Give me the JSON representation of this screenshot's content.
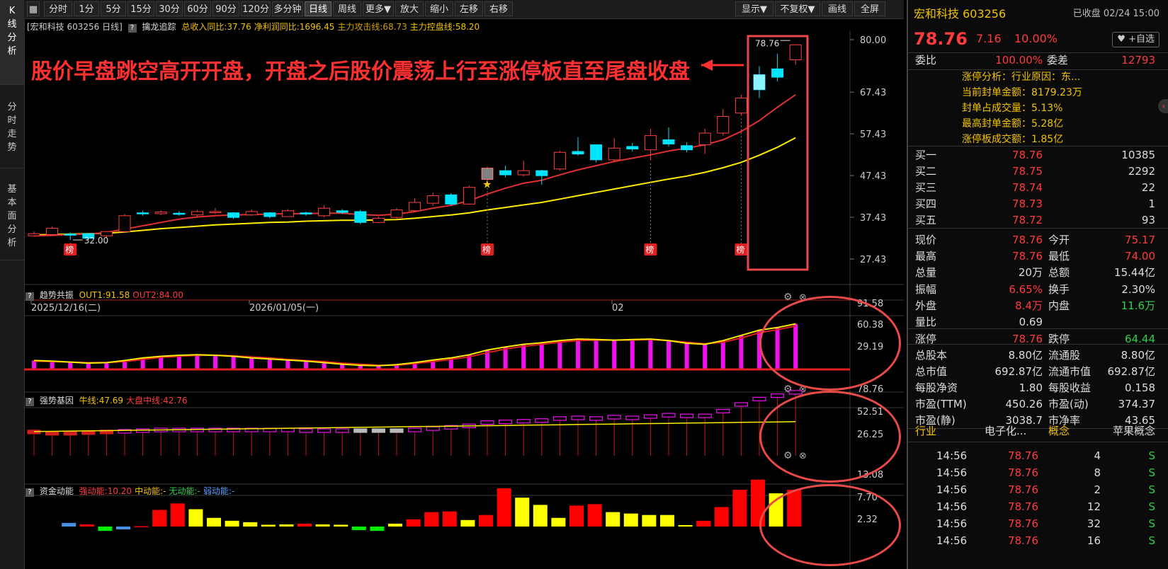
{
  "toolbar": {
    "buttons": [
      "分时",
      "1分",
      "5分",
      "15分",
      "30分",
      "60分",
      "90分",
      "120分",
      "多分钟",
      "日线",
      "周线",
      "更多▼",
      "放大",
      "缩小",
      "左移",
      "右移"
    ],
    "right_buttons": [
      "显示▼",
      "不复权▼",
      "画线",
      "全屏"
    ]
  },
  "left_tabs": [
    "K线分析",
    "分时走势",
    "基本面分析"
  ],
  "main_chart": {
    "title": "[宏和科技 603256 日线]",
    "indicator": "擒龙追踪",
    "items": [
      {
        "label": "总收入同比:37.76",
        "color": "#f3c300"
      },
      {
        "label": "净利润同比:1696.45",
        "color": "#f3c300"
      },
      {
        "label": "主力攻击线:68.73",
        "color": "#d0a000"
      },
      {
        "label": "主力控盘线:58.20",
        "color": "#f3c300"
      }
    ],
    "y_ticks": [
      "80.00",
      "67.43",
      "57.43",
      "47.43",
      "37.43",
      "27.43"
    ],
    "x_dates": [
      "2025/12/16(二)",
      "2026/01/05(一)",
      "02"
    ],
    "annotation": "股价早盘跳空高开开盘，开盘之后股价震荡上行至涨停板直至尾盘收盘",
    "high_label": "78.76",
    "low_label": "32.00",
    "bang": "榜"
  },
  "panel1": {
    "name": "趋势共振",
    "items": [
      {
        "label": "OUT1:91.58",
        "color": "#f3c300"
      },
      {
        "label": "OUT2:84.00",
        "color": "#ff3b3b"
      }
    ],
    "y_ticks": [
      "91.58",
      "60.38",
      "29.19"
    ]
  },
  "panel2": {
    "name": "强势基因",
    "items": [
      {
        "label": "牛线:47.69",
        "color": "#f3c300"
      },
      {
        "label": "大盘中线:42.76",
        "color": "#ff3b3b"
      }
    ],
    "y_ticks": [
      "78.76",
      "52.51",
      "26.25"
    ]
  },
  "panel3": {
    "name": "资金动能",
    "items": [
      {
        "label": "强动能:10.20",
        "color": "#ff3b3b"
      },
      {
        "label": "中动能:-",
        "color": "#f3c300"
      },
      {
        "label": "无动能:-",
        "color": "#2fd04a"
      },
      {
        "label": "弱动能:-",
        "color": "#5aa0ff"
      }
    ],
    "y_ticks": [
      "13.08",
      "7.70",
      "2.32"
    ]
  },
  "quote": {
    "name": "宏和科技 603256",
    "status": "已收盘 02/24 15:00",
    "price": "78.76",
    "change": "7.16",
    "pct": "10.00%",
    "watch": "+自选",
    "weibi_label": "委比",
    "weibi": "100.00%",
    "weicha_label": "委差",
    "weicha": "12793",
    "limit_info": [
      "涨停分析：行业原因：东...",
      "当前封单金额：8179.23万",
      "封单占成交量：5.13%",
      "最高封单金额：5.28亿",
      "涨停板成交额：1.85亿"
    ],
    "bids": [
      {
        "label": "买一",
        "price": "78.76",
        "vol": "10385"
      },
      {
        "label": "买二",
        "price": "78.75",
        "vol": "2292"
      },
      {
        "label": "买三",
        "price": "78.74",
        "vol": "22"
      },
      {
        "label": "买四",
        "price": "78.73",
        "vol": "1"
      },
      {
        "label": "买五",
        "price": "78.72",
        "vol": "93"
      }
    ],
    "stats": [
      {
        "l1": "现价",
        "v1": "78.76",
        "c1": "red",
        "l2": "今开",
        "v2": "75.17",
        "c2": "red"
      },
      {
        "l1": "最高",
        "v1": "78.76",
        "c1": "red",
        "l2": "最低",
        "v2": "74.00",
        "c2": "red"
      },
      {
        "l1": "总量",
        "v1": "20万",
        "c1": "white",
        "l2": "总额",
        "v2": "15.44亿",
        "c2": "white"
      },
      {
        "l1": "振幅",
        "v1": "6.65%",
        "c1": "red",
        "l2": "换手",
        "v2": "2.30%",
        "c2": "white"
      },
      {
        "l1": "外盘",
        "v1": "8.4万",
        "c1": "red",
        "l2": "内盘",
        "v2": "11.6万",
        "c2": "green"
      },
      {
        "l1": "量比",
        "v1": "0.69",
        "c1": "white",
        "l2": "",
        "v2": "",
        "c2": "white"
      },
      {
        "l1": "涨停",
        "v1": "78.76",
        "c1": "red",
        "l2": "跌停",
        "v2": "64.44",
        "c2": "green"
      },
      {
        "l1": "总股本",
        "v1": "8.80亿",
        "c1": "white",
        "l2": "流通股",
        "v2": "8.80亿",
        "c2": "white"
      },
      {
        "l1": "总市值",
        "v1": "692.87亿",
        "c1": "white",
        "l2": "流通市值",
        "v2": "692.87亿",
        "c2": "white"
      },
      {
        "l1": "每股净资",
        "v1": "1.80",
        "c1": "white",
        "l2": "每股收益",
        "v2": "0.158",
        "c2": "white"
      },
      {
        "l1": "市盈(TTM)",
        "v1": "450.26",
        "c1": "white",
        "l2": "市盈(动)",
        "v2": "374.37",
        "c2": "white"
      },
      {
        "l1": "市盈(静)",
        "v1": "3038.7",
        "c1": "white",
        "l2": "市净率",
        "v2": "43.65",
        "c2": "white"
      }
    ],
    "industry": {
      "l1": "行业",
      "v1": "电子化...",
      "l2": "概念",
      "v2": "苹果概念"
    },
    "ticks": [
      {
        "time": "14:56",
        "price": "78.76",
        "vol": "4",
        "side": "S"
      },
      {
        "time": "14:56",
        "price": "78.76",
        "vol": "8",
        "side": "S"
      },
      {
        "time": "14:56",
        "price": "78.76",
        "vol": "2",
        "side": "S"
      },
      {
        "time": "14:56",
        "price": "78.76",
        "vol": "12",
        "side": "S"
      },
      {
        "time": "14:56",
        "price": "78.76",
        "vol": "32",
        "side": "S"
      },
      {
        "time": "14:56",
        "price": "78.76",
        "vol": "16",
        "side": "S"
      }
    ]
  },
  "chart_data": {
    "type": "candlestick",
    "ylim": [
      27.43,
      80.0
    ],
    "candles": [
      {
        "o": 33.0,
        "c": 33.5,
        "h": 34.0,
        "l": 32.8
      },
      {
        "o": 33.3,
        "c": 34.8,
        "h": 35.2,
        "l": 33.0
      },
      {
        "o": 33.4,
        "c": 33.2,
        "h": 33.8,
        "l": 32.0
      },
      {
        "o": 33.5,
        "c": 32.4,
        "h": 33.6,
        "l": 32.0
      },
      {
        "o": 33.0,
        "c": 34.0,
        "h": 34.2,
        "l": 32.6
      },
      {
        "o": 34.0,
        "c": 37.8,
        "h": 38.2,
        "l": 33.8
      },
      {
        "o": 38.5,
        "c": 38.3,
        "h": 39.0,
        "l": 37.8
      },
      {
        "o": 38.3,
        "c": 38.7,
        "h": 39.1,
        "l": 38.0
      },
      {
        "o": 38.4,
        "c": 38.2,
        "h": 38.9,
        "l": 37.8
      },
      {
        "o": 38.0,
        "c": 38.8,
        "h": 39.2,
        "l": 37.6
      },
      {
        "o": 38.6,
        "c": 38.8,
        "h": 39.6,
        "l": 38.2
      },
      {
        "o": 38.5,
        "c": 37.4,
        "h": 38.7,
        "l": 37.0
      },
      {
        "o": 38.0,
        "c": 38.8,
        "h": 39.3,
        "l": 37.8
      },
      {
        "o": 38.5,
        "c": 37.6,
        "h": 38.7,
        "l": 37.2
      },
      {
        "o": 37.6,
        "c": 39.0,
        "h": 39.4,
        "l": 37.5
      },
      {
        "o": 38.5,
        "c": 38.2,
        "h": 38.8,
        "l": 37.8
      },
      {
        "o": 37.8,
        "c": 39.6,
        "h": 40.3,
        "l": 37.4
      },
      {
        "o": 39.0,
        "c": 38.6,
        "h": 39.4,
        "l": 38.2
      },
      {
        "o": 38.8,
        "c": 36.2,
        "h": 39.2,
        "l": 35.8
      },
      {
        "o": 36.2,
        "c": 37.2,
        "h": 37.6,
        "l": 36.0
      },
      {
        "o": 37.4,
        "c": 39.2,
        "h": 39.6,
        "l": 37.0
      },
      {
        "o": 39.0,
        "c": 41.0,
        "h": 42.0,
        "l": 38.8
      },
      {
        "o": 40.8,
        "c": 42.6,
        "h": 43.4,
        "l": 40.2
      },
      {
        "o": 42.8,
        "c": 40.6,
        "h": 43.2,
        "l": 40.2
      },
      {
        "o": 40.6,
        "c": 44.6,
        "h": 45.0,
        "l": 40.4
      },
      {
        "o": 46.5,
        "c": 49.2,
        "h": 49.6,
        "l": 46.0
      },
      {
        "o": 48.6,
        "c": 47.6,
        "h": 49.8,
        "l": 47.0
      },
      {
        "o": 47.6,
        "c": 48.6,
        "h": 51.0,
        "l": 47.2
      },
      {
        "o": 48.6,
        "c": 47.4,
        "h": 48.8,
        "l": 45.2
      },
      {
        "o": 49.0,
        "c": 53.0,
        "h": 53.4,
        "l": 48.6
      },
      {
        "o": 53.2,
        "c": 52.6,
        "h": 56.6,
        "l": 52.2
      },
      {
        "o": 54.8,
        "c": 51.2,
        "h": 54.8,
        "l": 50.6
      },
      {
        "o": 51.2,
        "c": 54.0,
        "h": 56.4,
        "l": 50.6
      },
      {
        "o": 54.4,
        "c": 53.8,
        "h": 55.2,
        "l": 53.2
      },
      {
        "o": 53.6,
        "c": 57.0,
        "h": 58.6,
        "l": 51.0
      },
      {
        "o": 56.0,
        "c": 55.0,
        "h": 59.0,
        "l": 54.4
      },
      {
        "o": 54.6,
        "c": 53.6,
        "h": 55.4,
        "l": 53.0
      },
      {
        "o": 54.8,
        "c": 57.6,
        "h": 58.6,
        "l": 52.6
      },
      {
        "o": 57.6,
        "c": 61.6,
        "h": 63.4,
        "l": 57.0
      },
      {
        "o": 62.4,
        "c": 66.0,
        "h": 66.8,
        "l": 61.8
      },
      {
        "o": 71.6,
        "c": 68.0,
        "h": 73.6,
        "l": 66.0
      },
      {
        "o": 73.0,
        "c": 71.0,
        "h": 76.6,
        "l": 70.0
      },
      {
        "o": 75.17,
        "c": 78.76,
        "h": 78.76,
        "l": 74.0
      }
    ],
    "ma_yellow": [
      33.2,
      33.3,
      33.4,
      33.5,
      33.6,
      33.9,
      34.3,
      34.7,
      35.0,
      35.3,
      35.6,
      35.8,
      36.0,
      36.2,
      36.3,
      36.5,
      36.6,
      36.7,
      36.7,
      36.8,
      36.9,
      37.2,
      37.6,
      38.0,
      38.5,
      39.2,
      39.8,
      40.4,
      41.0,
      41.8,
      42.6,
      43.4,
      44.2,
      45.0,
      45.8,
      46.6,
      47.3,
      48.2,
      49.3,
      50.6,
      52.3,
      54.2,
      56.5
    ],
    "ma_red": [
      33.0,
      33.1,
      33.3,
      33.4,
      33.8,
      34.6,
      35.4,
      36.2,
      37.0,
      37.5,
      37.8,
      38.0,
      38.1,
      38.2,
      38.3,
      38.3,
      38.4,
      38.4,
      38.1,
      37.9,
      38.2,
      38.8,
      39.6,
      40.3,
      41.4,
      43.0,
      44.4,
      45.6,
      46.3,
      47.6,
      48.8,
      49.8,
      50.8,
      51.6,
      52.4,
      53.3,
      54.0,
      54.8,
      56.0,
      58.0,
      60.6,
      63.8,
      66.8
    ],
    "bang_marks": [
      2,
      25,
      34,
      39
    ],
    "p1_out1": [
      0.17,
      0.16,
      0.14,
      0.12,
      0.13,
      0.17,
      0.22,
      0.25,
      0.27,
      0.28,
      0.27,
      0.25,
      0.22,
      0.2,
      0.18,
      0.16,
      0.13,
      0.1,
      0.08,
      0.07,
      0.09,
      0.13,
      0.18,
      0.22,
      0.28,
      0.37,
      0.43,
      0.48,
      0.51,
      0.55,
      0.58,
      0.57,
      0.56,
      0.57,
      0.58,
      0.55,
      0.5,
      0.48,
      0.55,
      0.65,
      0.75,
      0.8,
      0.87
    ],
    "p1_out2": [
      0.16,
      0.15,
      0.14,
      0.13,
      0.13,
      0.15,
      0.19,
      0.23,
      0.25,
      0.27,
      0.27,
      0.26,
      0.24,
      0.22,
      0.19,
      0.17,
      0.15,
      0.12,
      0.1,
      0.08,
      0.08,
      0.11,
      0.15,
      0.19,
      0.24,
      0.32,
      0.39,
      0.44,
      0.48,
      0.52,
      0.55,
      0.56,
      0.56,
      0.56,
      0.57,
      0.55,
      0.52,
      0.49,
      0.52,
      0.6,
      0.7,
      0.76,
      0.83
    ],
    "p2_gene": [
      0.38,
      0.36,
      0.36,
      0.37,
      0.38,
      0.39,
      0.4,
      0.41,
      0.41,
      0.41,
      0.41,
      0.41,
      0.41,
      0.41,
      0.41,
      0.4,
      0.4,
      0.4,
      0.4,
      0.4,
      0.4,
      0.41,
      0.43,
      0.45,
      0.47,
      0.52,
      0.53,
      0.54,
      0.55,
      0.58,
      0.59,
      0.58,
      0.6,
      0.59,
      0.61,
      0.63,
      0.62,
      0.62,
      0.69,
      0.79,
      0.87,
      0.92,
      0.97
    ],
    "p2_gene_color": [
      "r",
      "r",
      "r",
      "r",
      "r",
      "m",
      "m",
      "m",
      "m",
      "m",
      "m",
      "m",
      "m",
      "m",
      "m",
      "m",
      "m",
      "m",
      "w",
      "w",
      "w",
      "m",
      "m",
      "m",
      "m",
      "m",
      "m",
      "m",
      "m",
      "m",
      "m",
      "m",
      "m",
      "m",
      "m",
      "m",
      "m",
      "m",
      "m",
      "m",
      "m",
      "m",
      "m"
    ],
    "p3_values": [
      1.0,
      0.6,
      -1.2,
      -0.8,
      0.1,
      4.6,
      6.4,
      4.8,
      2.4,
      1.6,
      1.2,
      0.5,
      0.6,
      0.8,
      0.6,
      0.5,
      -1.0,
      -1.2,
      0.8,
      2.0,
      4.0,
      4.2,
      1.8,
      3.2,
      10.6,
      8.0,
      6.0,
      2.4,
      5.8,
      6.2,
      4.0,
      3.6,
      3.2,
      3.2,
      0.4,
      1.6,
      5.4,
      10.2,
      13.0,
      9.2,
      10.2
    ],
    "p3_colors": [
      "b",
      "r",
      "g",
      "b",
      "r",
      "r",
      "r",
      "y",
      "y",
      "y",
      "y",
      "y",
      "y",
      "r",
      "y",
      "y",
      "g",
      "g",
      "y",
      "r",
      "r",
      "r",
      "y",
      "r",
      "r",
      "y",
      "y",
      "y",
      "r",
      "r",
      "y",
      "y",
      "y",
      "y",
      "y",
      "r",
      "r",
      "r",
      "r",
      "y",
      "r"
    ]
  }
}
